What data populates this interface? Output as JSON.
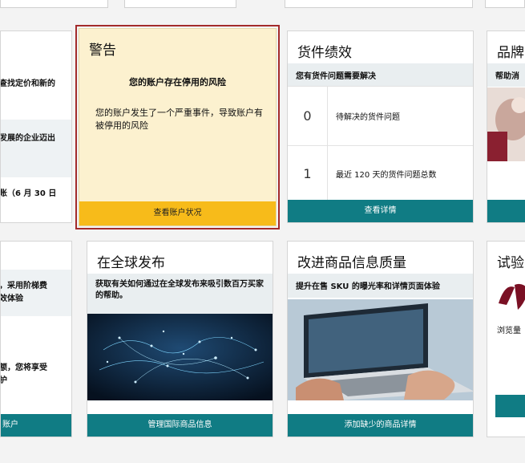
{
  "alert_card": {
    "title": "警告",
    "heading": "您的账户存在停用的风险",
    "body": "您的账户发生了一个严重事件，导致账户有被停用的风险",
    "action": "查看账户状况"
  },
  "shipment_card": {
    "title": "货件绩效",
    "band": "您有货件问题需要解决",
    "metrics": [
      {
        "value": "0",
        "label": "待解决的货件问题"
      },
      {
        "value": "1",
        "label": "最近 120 天的货件问题总数"
      }
    ],
    "action": "查看详情"
  },
  "brand_card": {
    "title": "品牌",
    "band": "帮助消"
  },
  "left_top_card": {
    "line1": "查找定价和新的",
    "line2": "发展的企业迈出",
    "line3": "账（6 月 30 日"
  },
  "global_card": {
    "title": "在全球发布",
    "band": "获取有关如何通过在全球发布来吸引数百万买家的帮助。",
    "action": "管理国际商品信息"
  },
  "listing_quality_card": {
    "title": "改进商品信息质量",
    "band": "提升在售 SKU 的曝光率和详情页面体验",
    "action": "添加缺少的商品详情"
  },
  "trial_card": {
    "title": "试验",
    "body": "浏览量"
  },
  "left_bottom_card": {
    "line1": "，采用阶梯费",
    "line2": "效体验",
    "line3": "额，您将享受",
    "line4": "护",
    "action": "账户"
  }
}
